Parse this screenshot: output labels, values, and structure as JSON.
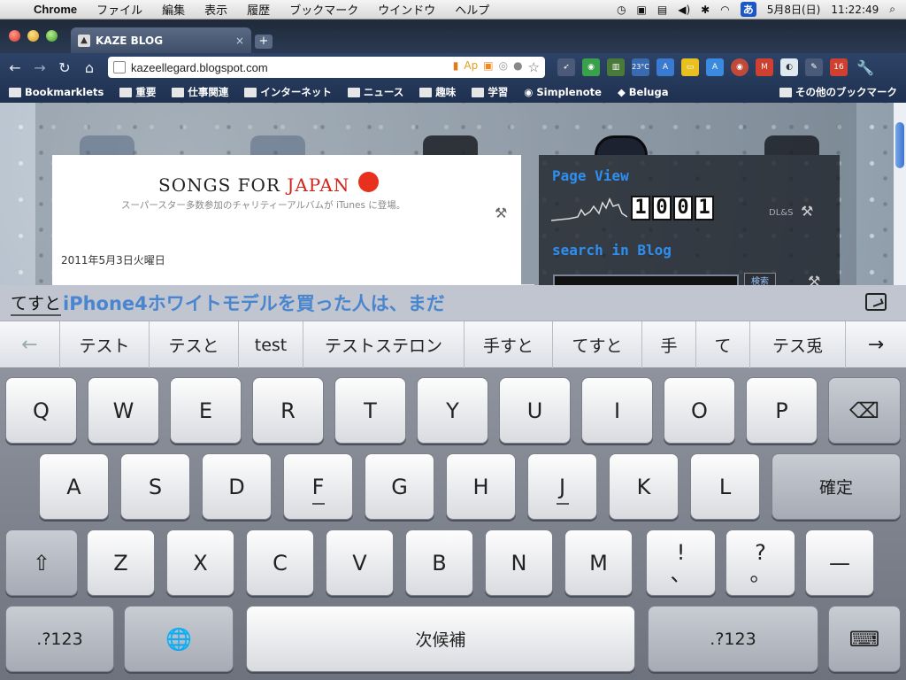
{
  "menubar": {
    "apple_icon": "apple-icon",
    "app_name": "Chrome",
    "menus": [
      "ファイル",
      "編集",
      "表示",
      "履歴",
      "ブックマーク",
      "ウインドウ",
      "ヘルプ"
    ],
    "status_icons": [
      "time-machine-icon",
      "chat-icon",
      "password-icon",
      "volume-icon",
      "bluetooth-icon",
      "wifi-icon"
    ],
    "input_method_badge": "あ",
    "date": "5月8日(日)",
    "time": "11:22:49"
  },
  "tab": {
    "title": "KAZE BLOG",
    "close_glyph": "×",
    "new_tab_glyph": "+"
  },
  "toolbar": {
    "back_glyph": "←",
    "forward_glyph": "→",
    "reload_glyph": "↻",
    "home_glyph": "⌂",
    "url": "kazeellegard.blogspot.com",
    "omnibox_ext_text": "Ap",
    "star_glyph": "☆",
    "weather_text": "23°C",
    "gmail_badge": "16",
    "wrench_glyph": "🔧",
    "accent": "#2e4368"
  },
  "bookmarks": {
    "items": [
      "Bookmarklets",
      "重要",
      "仕事関連",
      "インターネット",
      "ニュース",
      "趣味",
      "学習",
      "Simplenote",
      "Beluga"
    ],
    "other": "その他のブックマーク"
  },
  "page": {
    "banner_title_1": "SONGS FOR",
    "banner_title_2": "JAPAN",
    "banner_subtitle": "スーパースター多数参加のチャリティーアルバムが iTunes に登場。",
    "post_date": "2011年5月3日火曜日",
    "page_view_heading": "Page View",
    "counter_digits": [
      "1",
      "0",
      "0",
      "1"
    ],
    "search_heading": "search in Blog",
    "search_button": "検索",
    "tools_glyph": "⚒",
    "side_label": "DL&S",
    "accent_blue": "#2f8ff0"
  },
  "composition": {
    "typed": "てすと",
    "prediction": "iPhone4ホワイトモデルを買った人は、まだ"
  },
  "candidates": {
    "prev_glyph": "←",
    "next_glyph": "→",
    "items": [
      "テスト",
      "テスと",
      "test",
      "テストステロン",
      "手すと",
      "てすと",
      "手",
      "て",
      "テス兎"
    ]
  },
  "keyboard": {
    "row1": [
      "Q",
      "W",
      "E",
      "R",
      "T",
      "Y",
      "U",
      "I",
      "O",
      "P"
    ],
    "row2": [
      "A",
      "S",
      "D",
      "F",
      "G",
      "H",
      "J",
      "K",
      "L"
    ],
    "row3": [
      "Z",
      "X",
      "C",
      "V",
      "B",
      "N",
      "M"
    ],
    "delete_glyph": "⌫",
    "confirm": "確定",
    "shift_glyph": "⇧",
    "exclaim_top": "!",
    "exclaim_bottom": "、",
    "question_top": "?",
    "question_bottom": "。",
    "dash": "—",
    "numbers": ".?123",
    "globe_glyph": "🌐",
    "space": "次候補",
    "numbers_right": ".?123",
    "hide_keyboard_glyph": "⌨"
  }
}
